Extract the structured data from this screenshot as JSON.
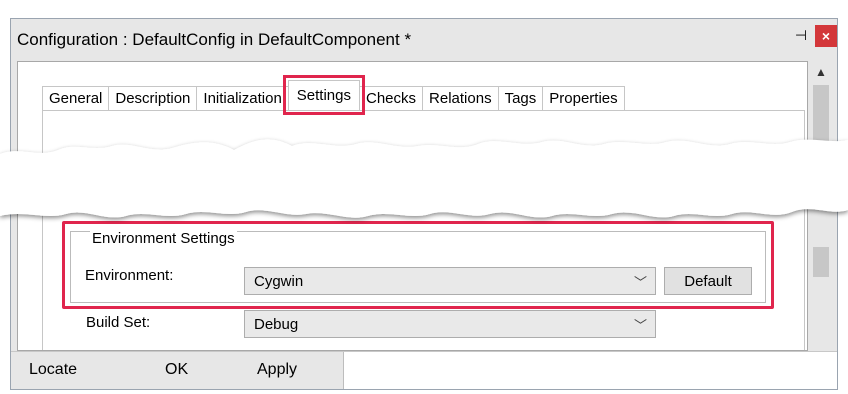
{
  "window": {
    "title": "Configuration : DefaultConfig in DefaultComponent *",
    "pin_glyph": "⊣",
    "close_glyph": "×"
  },
  "tabs": [
    {
      "label": "General"
    },
    {
      "label": "Description"
    },
    {
      "label": "Initialization"
    },
    {
      "label": "Settings",
      "active": true
    },
    {
      "label": "Checks"
    },
    {
      "label": "Relations"
    },
    {
      "label": "Tags"
    },
    {
      "label": "Properties"
    }
  ],
  "environment_settings": {
    "group_title": "Environment Settings",
    "environment_label": "Environment:",
    "environment_value": "Cygwin",
    "default_button": "Default",
    "build_set_label": "Build Set:",
    "build_set_value": "Debug"
  },
  "bottom_bar": {
    "locate": "Locate",
    "ok": "OK",
    "apply": "Apply"
  },
  "colors": {
    "highlight": "#e0254d",
    "close_button": "#d3373a",
    "window_bg": "#e7e7e7"
  }
}
